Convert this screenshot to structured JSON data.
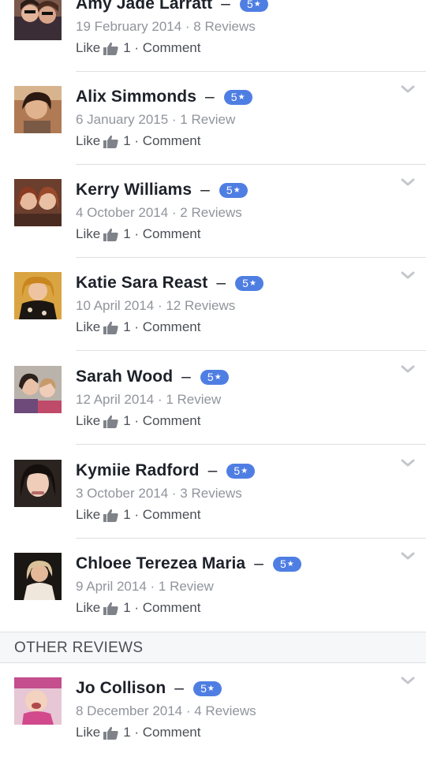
{
  "reviews": [
    {
      "name": "Amy Jade Larratt",
      "dash": "–",
      "rating": "5",
      "star": "★",
      "meta": "19 February 2014 · 8 Reviews",
      "like": "Like",
      "likes": "1",
      "comment": "Comment"
    },
    {
      "name": "Alix Simmonds",
      "dash": "–",
      "rating": "5",
      "star": "★",
      "meta": "6 January 2015 · 1 Review",
      "like": "Like",
      "likes": "1",
      "comment": "Comment"
    },
    {
      "name": "Kerry Williams",
      "dash": "–",
      "rating": "5",
      "star": "★",
      "meta": "4 October 2014 · 2 Reviews",
      "like": "Like",
      "likes": "1",
      "comment": "Comment"
    },
    {
      "name": "Katie Sara Reast",
      "dash": "–",
      "rating": "5",
      "star": "★",
      "meta": "10 April 2014 · 12 Reviews",
      "like": "Like",
      "likes": "1",
      "comment": "Comment"
    },
    {
      "name": "Sarah Wood",
      "dash": "–",
      "rating": "5",
      "star": "★",
      "meta": "12 April 2014 · 1 Review",
      "like": "Like",
      "likes": "1",
      "comment": "Comment"
    },
    {
      "name": "Kymiie Radford",
      "dash": "–",
      "rating": "5",
      "star": "★",
      "meta": "3 October 2014 · 3 Reviews",
      "like": "Like",
      "likes": "1",
      "comment": "Comment"
    },
    {
      "name": "Chloee Terezea Maria",
      "dash": "–",
      "rating": "5",
      "star": "★",
      "meta": "9 April 2014 · 1 Review",
      "like": "Like",
      "likes": "1",
      "comment": "Comment"
    }
  ],
  "other_section": {
    "title": "OTHER REVIEWS",
    "reviews": [
      {
        "name": "Jo Collison",
        "dash": "–",
        "rating": "5",
        "star": "★",
        "meta": "8 December 2014 · 4 Reviews",
        "like": "Like",
        "likes": "1",
        "comment": "Comment"
      }
    ]
  },
  "colors": {
    "badge": "#4f7ee3",
    "name_text": "#1d2129",
    "meta_text": "#90949c",
    "action_text": "#4b4f56",
    "divider": "#dddfe2"
  },
  "icons": {
    "like": "thumbs-up-icon",
    "expand": "chevron-down-icon"
  }
}
